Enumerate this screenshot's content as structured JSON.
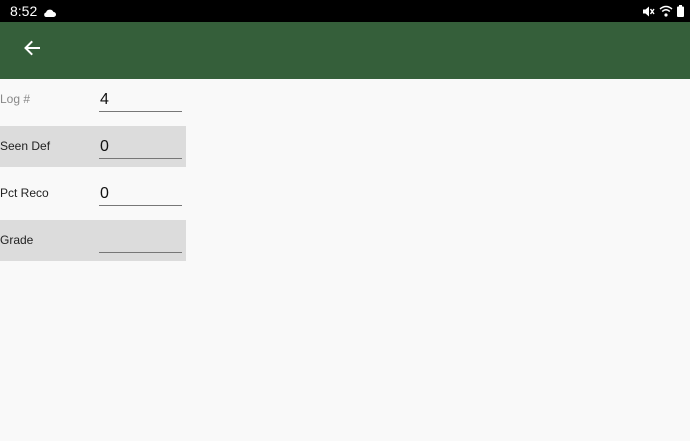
{
  "status_bar": {
    "time": "8:52",
    "icons": [
      "cloud-icon",
      "mute-icon",
      "wifi-icon",
      "battery-icon"
    ]
  },
  "app_bar": {
    "color": "#355f3a",
    "back_icon": "arrow-left-icon"
  },
  "form": {
    "rows": [
      {
        "label": "Log #",
        "value": "4"
      },
      {
        "label": "Seen Def",
        "value": "0"
      },
      {
        "label": "Pct Reco",
        "value": "0"
      },
      {
        "label": "Grade",
        "value": ""
      }
    ]
  }
}
